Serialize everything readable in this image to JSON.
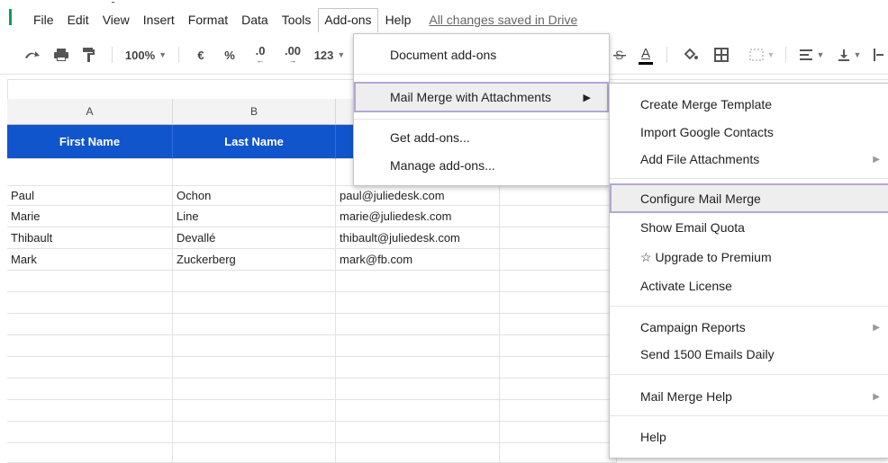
{
  "menubar": {
    "items": [
      "File",
      "Edit",
      "View",
      "Insert",
      "Format",
      "Data",
      "Tools",
      "Add-ons",
      "Help"
    ],
    "saved_status": "All changes saved in Drive"
  },
  "toolbar": {
    "zoom": "100%",
    "currency": "€",
    "percent": "%",
    "decrease_decimal": ".0",
    "increase_decimal": ".00",
    "more_formats": "123",
    "text_color_label": "A"
  },
  "columns": [
    "A",
    "B"
  ],
  "header_row": [
    "First Name",
    "Last Name"
  ],
  "rows": [
    [
      "Paul",
      "Ochon",
      "paul@juliedesk.com"
    ],
    [
      "Marie",
      "Line",
      "marie@juliedesk.com"
    ],
    [
      "Thibault",
      "Devallé",
      "thibault@juliedesk.com"
    ],
    [
      "Mark",
      "Zuckerberg",
      "mark@fb.com"
    ]
  ],
  "addons_menu": {
    "document_addons": "Document add-ons",
    "mail_merge": "Mail Merge with Attachments",
    "get_addons": "Get add-ons...",
    "manage_addons": "Manage add-ons..."
  },
  "submenu": {
    "create_template": "Create Merge Template",
    "import_contacts": "Import Google Contacts",
    "add_attachments": "Add File Attachments",
    "configure": "Configure Mail Merge",
    "show_quota": "Show Email Quota",
    "upgrade": "☆ Upgrade to Premium",
    "activate": "Activate License",
    "campaign_reports": "Campaign Reports",
    "send_daily": "Send 1500 Emails Daily",
    "help_menu": "Mail Merge Help",
    "help": "Help"
  },
  "colors": {
    "header_fill": "#1155cc",
    "hover_border": "#b4a7d6",
    "logo_green": "#0f9d58"
  }
}
